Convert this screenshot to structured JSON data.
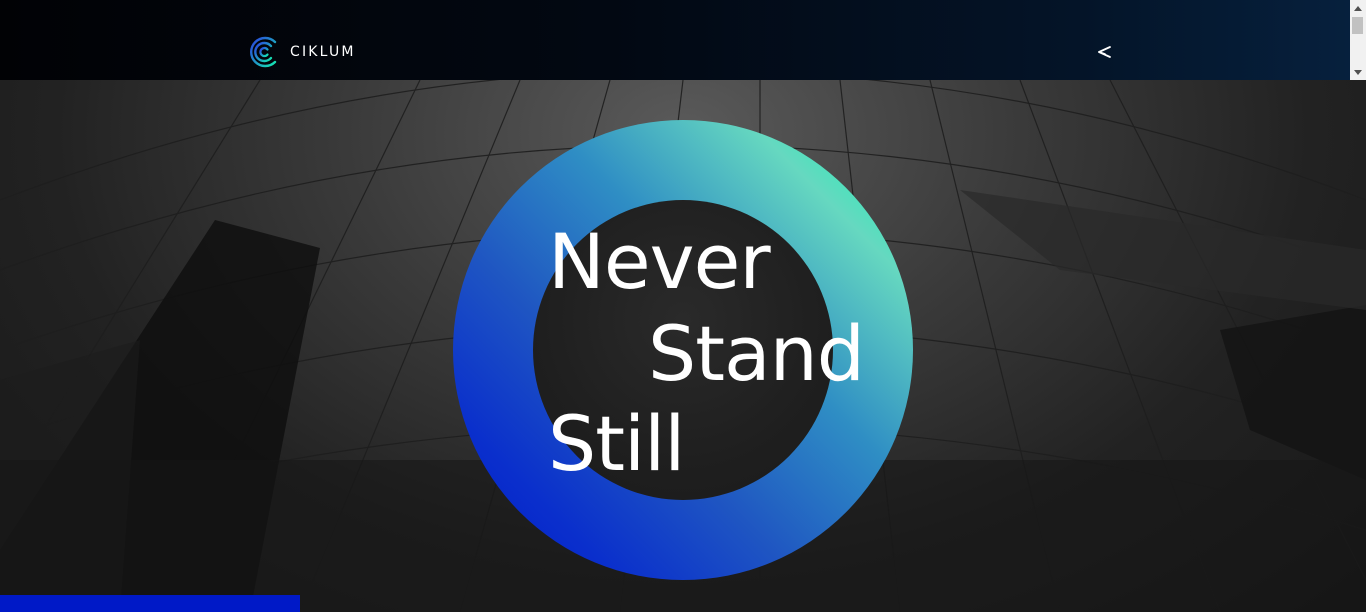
{
  "header": {
    "brand_name": "CIKLUM",
    "share_icon": "share-icon"
  },
  "hero": {
    "headline": {
      "line1": "Never",
      "line2": "Stand",
      "line3": "Still"
    }
  },
  "colors": {
    "ring_start": "#00ffb0",
    "ring_end": "#0019c7",
    "brand_blue": "#0019c7"
  }
}
